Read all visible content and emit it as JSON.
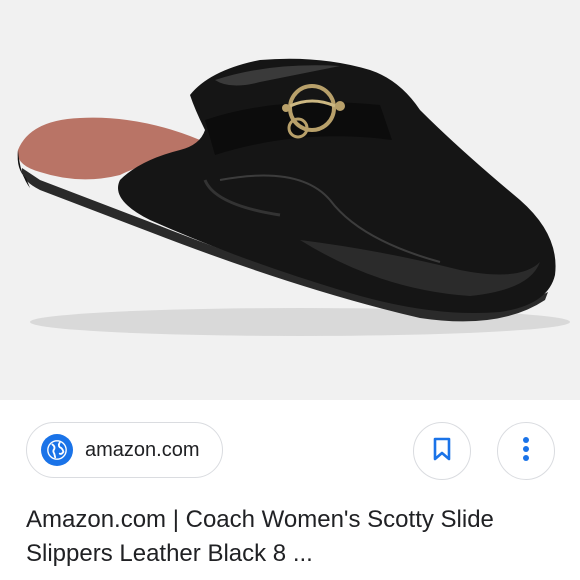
{
  "result": {
    "image_alt": "Black leather slide slipper with gold-tone ring hardware",
    "source": "amazon.com",
    "title": "Amazon.com | Coach Women's Scotty Slide Slippers Leather Black 8 ..."
  },
  "icons": {
    "source": "globe-icon",
    "save": "bookmark-icon",
    "more": "more-vertical-icon"
  },
  "colors": {
    "accent": "#1a73e8",
    "text": "#202124",
    "border": "#dadce0"
  }
}
